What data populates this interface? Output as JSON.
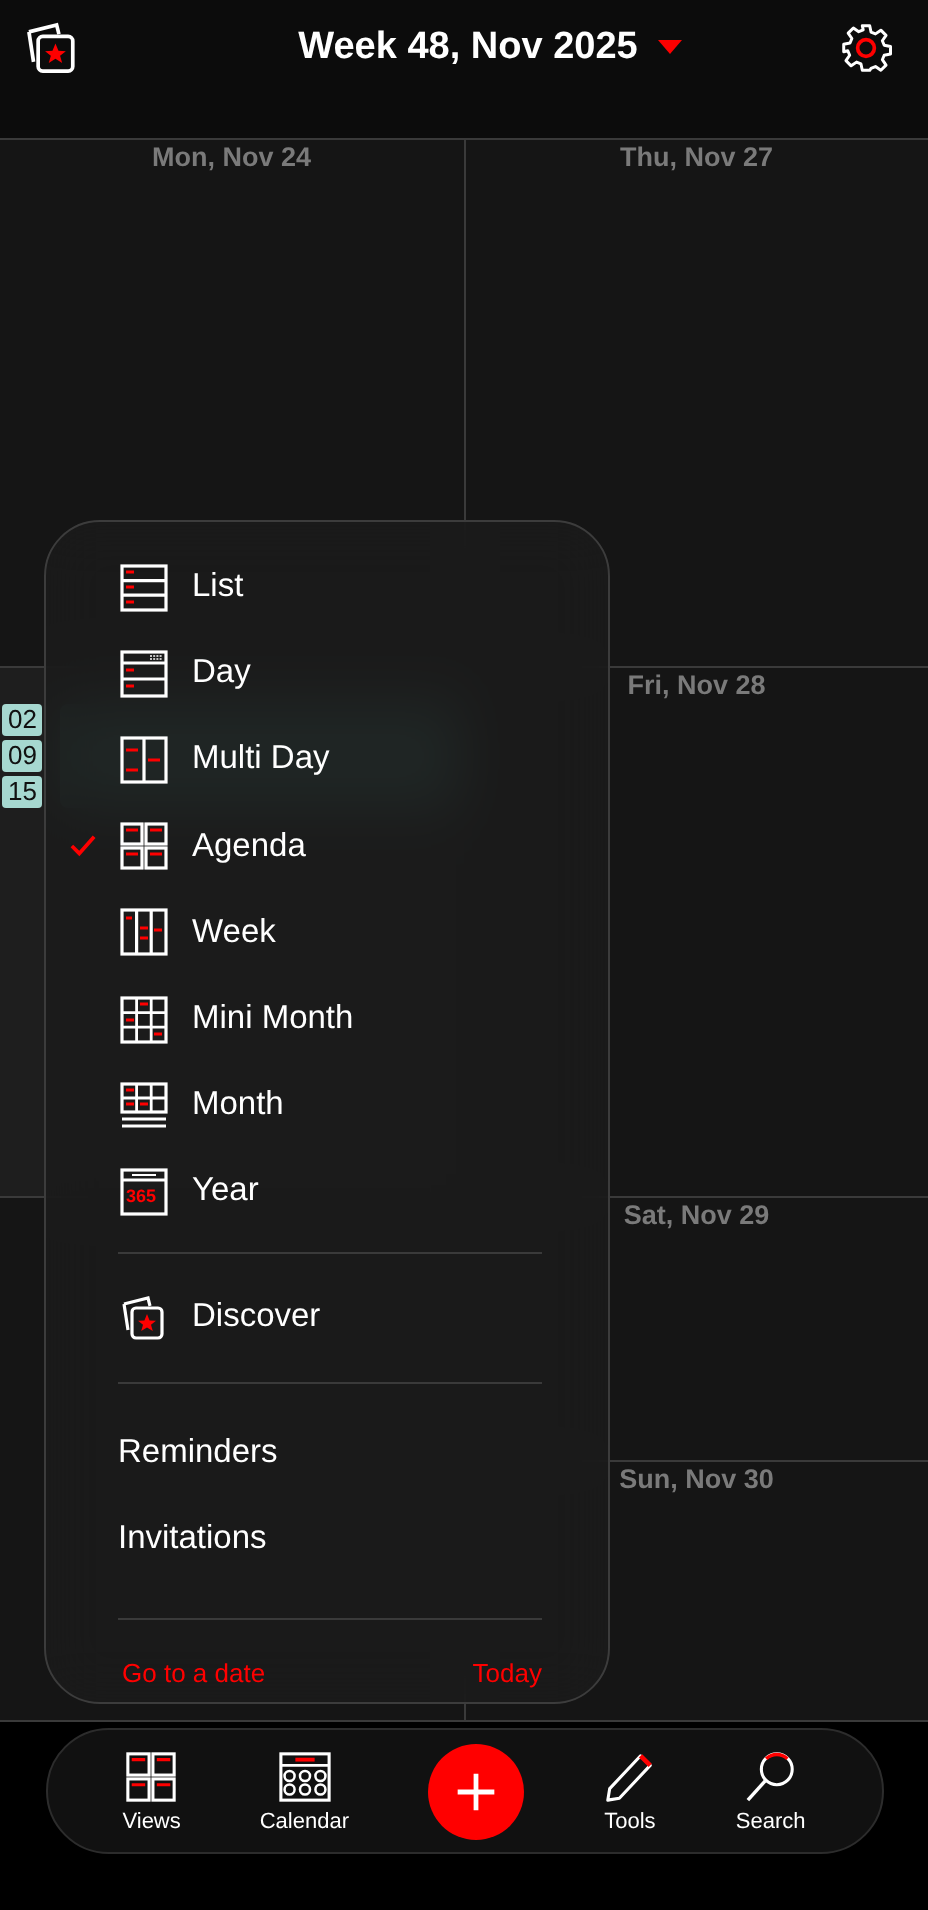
{
  "header": {
    "title": "Week 48, Nov 2025"
  },
  "columns": [
    {
      "cells": [
        {
          "label": "Mon, Nov 24"
        },
        {
          "events": [
            {
              "time": "02"
            },
            {
              "time": "09"
            },
            {
              "time": "15"
            }
          ]
        },
        {}
      ]
    },
    {
      "cells": [
        {
          "label": "Thu, Nov 27"
        },
        {
          "label": "Fri, Nov 28"
        },
        {
          "label": "Sat, Nov 29"
        },
        {
          "label": "Sun, Nov 30"
        }
      ]
    }
  ],
  "menu": {
    "views": [
      {
        "label": "List",
        "kind": "list",
        "selected": false
      },
      {
        "label": "Day",
        "kind": "day",
        "selected": false
      },
      {
        "label": "Multi Day",
        "kind": "multiday",
        "selected": false
      },
      {
        "label": "Agenda",
        "kind": "agenda",
        "selected": true
      },
      {
        "label": "Week",
        "kind": "week",
        "selected": false
      },
      {
        "label": "Mini Month",
        "kind": "minimonth",
        "selected": false
      },
      {
        "label": "Month",
        "kind": "month",
        "selected": false
      },
      {
        "label": "Year",
        "kind": "year",
        "selected": false,
        "icon_text": "365"
      }
    ],
    "discover": {
      "label": "Discover"
    },
    "other": [
      "Reminders",
      "Invitations"
    ],
    "footer": {
      "left": "Go to a date",
      "right": "Today"
    }
  },
  "tabbar": [
    {
      "label": "Views",
      "kind": "views"
    },
    {
      "label": "Calendar",
      "kind": "calendar"
    },
    {
      "kind": "add"
    },
    {
      "label": "Tools",
      "kind": "tools"
    },
    {
      "label": "Search",
      "kind": "search"
    }
  ]
}
